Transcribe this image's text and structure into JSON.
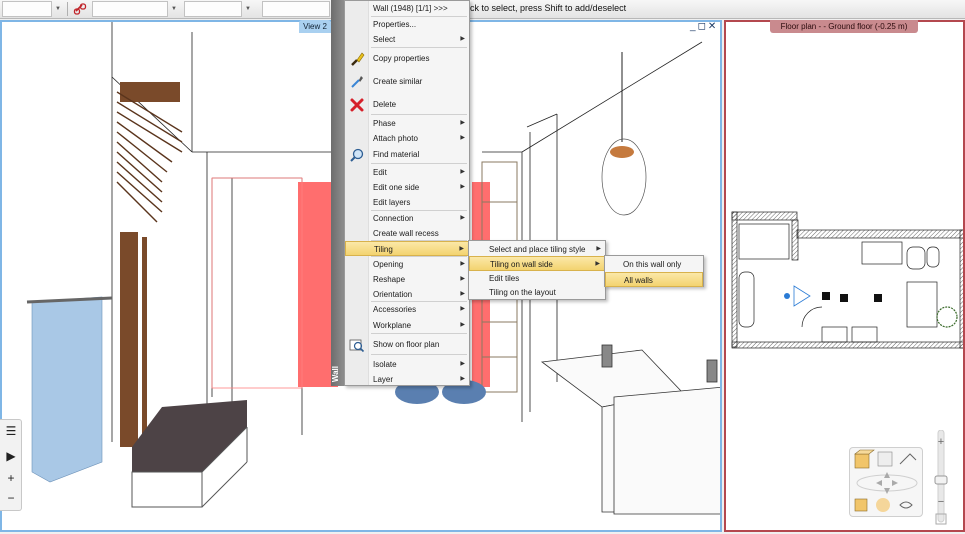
{
  "toolbar": {
    "status_hint": "ck to select, press Shift to add/deselect"
  },
  "view3d": {
    "tab_label": "View 2",
    "controls": {
      "minimize": "_",
      "restore": "◻",
      "close": "✕"
    }
  },
  "floorplan": {
    "tab_label": "Floor plan -   - Ground floor (-0.25 m)"
  },
  "wall_strip": {
    "label": "Wall"
  },
  "context_menu": {
    "header": "Wall (1948) [1/1] >>>",
    "items": [
      {
        "label": "Properties...",
        "submenu": false
      },
      {
        "label": "Select",
        "submenu": true
      },
      {
        "label": "Copy properties",
        "submenu": false,
        "icon": "paintbrush-icon"
      },
      {
        "label": "Create similar",
        "submenu": false,
        "icon": "pipette-icon"
      },
      {
        "label": "Delete",
        "submenu": false,
        "icon": "delete-x-icon"
      },
      {
        "label": "Phase",
        "submenu": true
      },
      {
        "label": "Attach photo",
        "submenu": true
      },
      {
        "label": "Find material",
        "submenu": false,
        "icon": "magnifier-icon"
      },
      {
        "label": "Edit",
        "submenu": true
      },
      {
        "label": "Edit one side",
        "submenu": true
      },
      {
        "label": "Edit layers",
        "submenu": false
      },
      {
        "label": "Connection",
        "submenu": true
      },
      {
        "label": "Create wall recess",
        "submenu": false
      },
      {
        "label": "Tiling",
        "submenu": true,
        "highlighted": true
      },
      {
        "label": "Opening",
        "submenu": true
      },
      {
        "label": "Reshape",
        "submenu": true
      },
      {
        "label": "Orientation",
        "submenu": true
      },
      {
        "label": "Accessories",
        "submenu": true
      },
      {
        "label": "Workplane",
        "submenu": true
      },
      {
        "label": "Show on floor plan",
        "submenu": false,
        "icon": "floorplan-zoom-icon"
      },
      {
        "label": "Isolate",
        "submenu": true
      },
      {
        "label": "Layer",
        "submenu": true
      }
    ]
  },
  "tiling_submenu": {
    "items": [
      {
        "label": "Select and place tiling style",
        "submenu": true
      },
      {
        "label": "Tiling on wall side",
        "submenu": true,
        "highlighted": true
      },
      {
        "label": "Edit tiles",
        "submenu": false
      },
      {
        "label": "Tiling on the layout",
        "submenu": false
      }
    ]
  },
  "wall_side_submenu": {
    "items": [
      {
        "label": "On this wall only",
        "highlighted": false
      },
      {
        "label": "All walls",
        "highlighted": true
      }
    ]
  },
  "side_tools": {
    "list": "☰",
    "play": "▶",
    "zoom_in": "+",
    "zoom_out": "−"
  },
  "zoom_slider": {
    "plus": "+",
    "minus": "−"
  },
  "colors": {
    "view_border": "#7fb6e6",
    "plan_border": "#b4484f",
    "selected_wall": "#ff6e6e",
    "menu_highlight": "#f3d370"
  }
}
